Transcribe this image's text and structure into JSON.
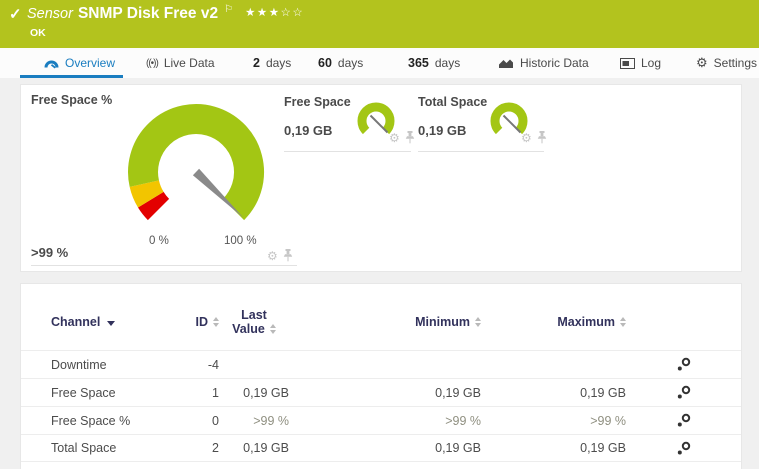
{
  "colors": {
    "header_bg": "#b3c31e",
    "accent_blue": "#1a7dc0",
    "gauge_ok": "#a3c614",
    "gauge_warn": "#f2c500",
    "gauge_error": "#e30000",
    "gauge_needle": "#8a8a8a",
    "table_header_text": "#32325c"
  },
  "header": {
    "check_icon": "✓",
    "kind": "Sensor",
    "title": "SNMP Disk Free v2",
    "flag_icon": "⚐",
    "stars_filled": "★★★",
    "stars_empty": "☆☆",
    "status": "OK"
  },
  "tabs": {
    "overview": "Overview",
    "live": "Live Data",
    "live_icon_glyph": "((•))",
    "d2_num": "2",
    "d2_unit": "days",
    "d60_num": "60",
    "d60_unit": "days",
    "d365_num": "365",
    "d365_unit": "days",
    "historic": "Historic Data",
    "log": "Log",
    "settings": "Settings",
    "settings_icon_glyph": "⚙"
  },
  "gauges": {
    "primary": {
      "title": "Free Space %",
      "value": ">99 %",
      "scale_min": "0 %",
      "scale_max": "100 %"
    },
    "free_space": {
      "title": "Free Space",
      "value": "0,19 GB"
    },
    "total_space": {
      "title": "Total Space",
      "value": "0,19 GB"
    },
    "gear_icon_glyph": "⚙"
  },
  "table": {
    "headers": {
      "channel": "Channel",
      "id": "ID",
      "last_line1": "Last",
      "last_line2": "Value",
      "minimum": "Minimum",
      "maximum": "Maximum"
    },
    "rows": [
      {
        "channel": "Downtime",
        "id": "-4",
        "last": "",
        "min": "",
        "max": ""
      },
      {
        "channel": "Free Space",
        "id": "1",
        "last": "0,19 GB",
        "min": "0,19 GB",
        "max": "0,19 GB"
      },
      {
        "channel": "Free Space %",
        "id": "0",
        "last": ">99 %",
        "min": ">99 %",
        "max": ">99 %"
      },
      {
        "channel": "Total Space",
        "id": "2",
        "last": "0,19 GB",
        "min": "0,19 GB",
        "max": "0,19 GB"
      }
    ]
  }
}
